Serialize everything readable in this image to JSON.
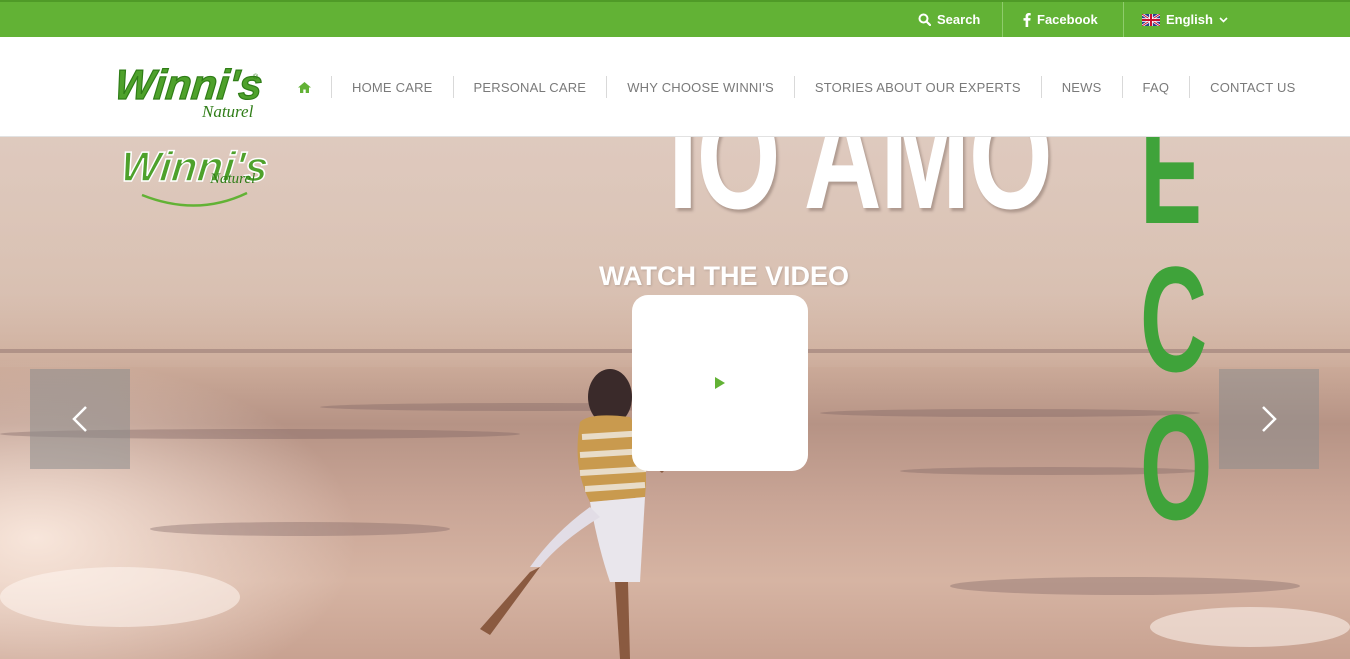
{
  "topbar": {
    "search_label": "Search",
    "facebook_label": "Facebook",
    "language_label": "English",
    "icons": {
      "search": "search-icon",
      "facebook": "facebook-icon",
      "flag": "uk-flag-icon",
      "chevron": "chevron-down-icon"
    },
    "color": "#62b235"
  },
  "header": {
    "logo_text": "Winni's",
    "logo_subtext": "Naturel",
    "nav": {
      "home_icon": "home-icon",
      "items": [
        {
          "label": "HOME CARE"
        },
        {
          "label": "PERSONAL CARE"
        },
        {
          "label": "WHY CHOOSE WINNI'S"
        },
        {
          "label": "STORIES ABOUT OUR EXPERTS"
        },
        {
          "label": "NEWS"
        },
        {
          "label": "FAQ"
        },
        {
          "label": "CONTACT US"
        }
      ]
    }
  },
  "hero": {
    "headline": "IO AMO",
    "eco_letters": [
      "E",
      "C",
      "O"
    ],
    "watch_label": "WATCH THE VIDEO",
    "play_icon": "play-icon",
    "prev_icon": "chevron-left-icon",
    "next_icon": "chevron-right-icon",
    "accent_color": "#3fa33a"
  }
}
